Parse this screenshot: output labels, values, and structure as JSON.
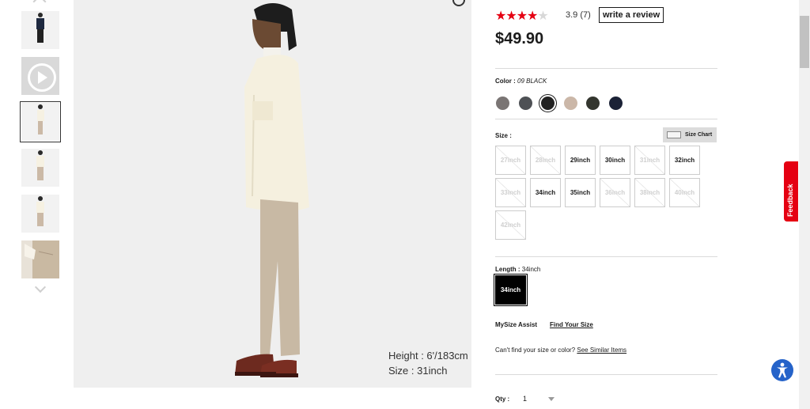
{
  "gallery": {
    "model_height": "Height : 6'/183cm",
    "model_size": "Size : 31inch"
  },
  "product": {
    "rating_value": "3.9",
    "rating_count": "(7)",
    "stars_filled": 4,
    "stars_total": 5,
    "review_button": "write a review",
    "price": "$49.90"
  },
  "color": {
    "label": "Color :",
    "selected": "09 BLACK",
    "swatches": [
      "#7a7574",
      "#4e5155",
      "#222222",
      "#cbb7a8",
      "#34362f",
      "#1b2236"
    ]
  },
  "size": {
    "label": "Size :",
    "chart_label": "Size Chart",
    "options": [
      {
        "label": "27inch",
        "available": false
      },
      {
        "label": "28inch",
        "available": false
      },
      {
        "label": "29inch",
        "available": true
      },
      {
        "label": "30inch",
        "available": true
      },
      {
        "label": "31inch",
        "available": false
      },
      {
        "label": "32inch",
        "available": true
      },
      {
        "label": "33inch",
        "available": false
      },
      {
        "label": "34inch",
        "available": true
      },
      {
        "label": "35inch",
        "available": true
      },
      {
        "label": "36inch",
        "available": false
      },
      {
        "label": "38inch",
        "available": false
      },
      {
        "label": "40inch",
        "available": false
      },
      {
        "label": "42inch",
        "available": false
      }
    ]
  },
  "length": {
    "label": "Length :",
    "value": "34inch",
    "option": "34inch"
  },
  "mysize": {
    "label": "MySize Assist",
    "link": "Find Your Size"
  },
  "help": {
    "text": "Can't find your size or color?",
    "link": "See Similar Items"
  },
  "quantity": {
    "label": "Qty :",
    "value": "1"
  },
  "feedback": "Feedback",
  "colors": {
    "accent": "#e50012",
    "a11y": "#2563c9"
  }
}
